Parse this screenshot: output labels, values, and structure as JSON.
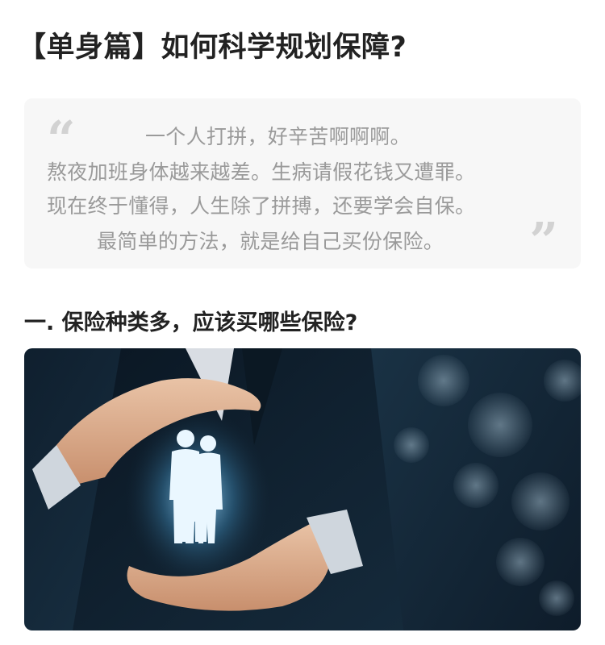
{
  "article": {
    "title": "【单身篇】如何科学规划保障?",
    "quote": {
      "open_mark": "“",
      "close_mark": "”",
      "lines": [
        "一个人打拼，好辛苦啊啊啊。",
        "熬夜加班身体越来越差。生病请假花钱又遭罪。",
        "现在终于懂得，人生除了拼搏，还要学会自保。",
        "最简单的方法，就是给自己买份保险。"
      ]
    },
    "section_1": {
      "heading": "一. 保险种类多，应该买哪些保险?"
    },
    "hero_image": {
      "icon": "family-protection-hands-illustration"
    }
  }
}
